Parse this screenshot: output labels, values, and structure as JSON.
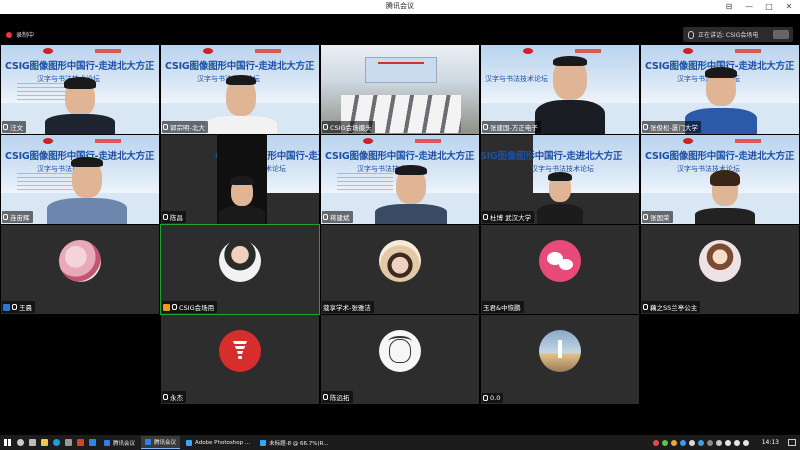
{
  "window": {
    "title": "腾讯会议"
  },
  "recording": {
    "label": "录制中"
  },
  "speaking": {
    "label": "正在讲话: CSIG会场电"
  },
  "banner": {
    "headline": "CSIG图像图形中国行-走进北大方正",
    "subtitle": "汉字与书法技术论坛"
  },
  "tiles": [
    {
      "name": "汪文",
      "kind": "video"
    },
    {
      "name": "郭宗明-北大",
      "kind": "video"
    },
    {
      "name": "CSIG会场摄头",
      "kind": "room"
    },
    {
      "name": "张建国-方正电子",
      "kind": "video"
    },
    {
      "name": "张俊松-厦门大学",
      "kind": "video"
    },
    {
      "name": "连宙辉",
      "kind": "video"
    },
    {
      "name": "陈昌",
      "kind": "video"
    },
    {
      "name": "蒋建斌",
      "kind": "video"
    },
    {
      "name": "杜博 武汉大学",
      "kind": "video"
    },
    {
      "name": "张国荣",
      "kind": "video"
    },
    {
      "name": "王晨",
      "kind": "avatar"
    },
    {
      "name": "CSIG会场用",
      "kind": "avatar"
    },
    {
      "name": "蔻享学术-张雅洁",
      "kind": "avatar"
    },
    {
      "name": "玉君&中恢鹏",
      "kind": "avatar"
    },
    {
      "name": "藕之SS兰亭公主",
      "kind": "avatar"
    },
    {
      "name": "永杰",
      "kind": "avatar"
    },
    {
      "name": "陈远拓",
      "kind": "avatar"
    },
    {
      "name": "0.0",
      "kind": "avatar"
    }
  ],
  "taskbar": {
    "apps": [
      {
        "label": "腾讯会议",
        "active": false,
        "color": "#2f7ff1"
      },
      {
        "label": "腾讯会议",
        "active": true,
        "color": "#2f7ff1"
      },
      {
        "label": "Adobe Photoshop ...",
        "active": false,
        "color": "#31a8ff"
      },
      {
        "label": "未标题-8 @ 66.7%(R...",
        "active": false,
        "color": "#31a8ff"
      }
    ],
    "clock": "14:13"
  }
}
